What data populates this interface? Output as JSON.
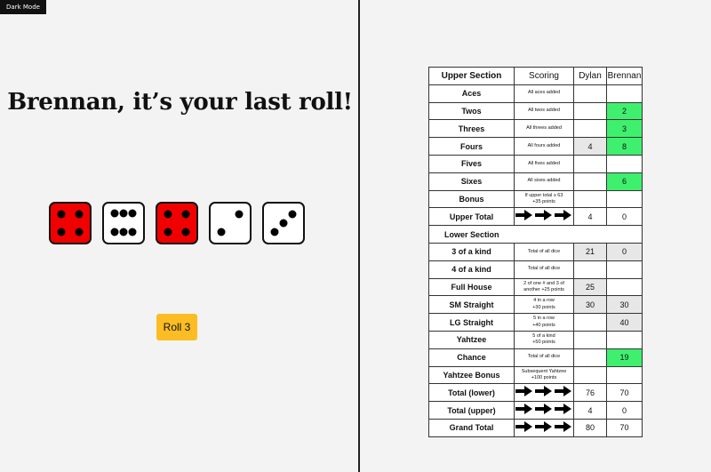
{
  "app": {
    "dark_mode_label": "Dark Mode"
  },
  "game": {
    "headline": "Brennan, it’s your last roll!",
    "roll_button": "Roll 3",
    "dice": [
      {
        "value": 4,
        "held": true
      },
      {
        "value": 6,
        "held": false
      },
      {
        "value": 4,
        "held": true
      },
      {
        "value": 2,
        "held": false
      },
      {
        "value": 3,
        "held": false
      }
    ]
  },
  "scorecard": {
    "headers": {
      "section": "Upper Section",
      "scoring": "Scoring",
      "player1": "Dylan",
      "player2": "Brennan"
    },
    "rows": [
      {
        "name": "Aces",
        "scoring": "All aces added",
        "p1": "",
        "p2": "",
        "p1_state": "",
        "p2_state": ""
      },
      {
        "name": "Twos",
        "scoring": "All twos added",
        "p1": "",
        "p2": "2",
        "p1_state": "",
        "p2_state": "green"
      },
      {
        "name": "Threes",
        "scoring": "All threes added",
        "p1": "",
        "p2": "3",
        "p1_state": "",
        "p2_state": "green"
      },
      {
        "name": "Fours",
        "scoring": "All fours added",
        "p1": "4",
        "p2": "8",
        "p1_state": "filled",
        "p2_state": "green"
      },
      {
        "name": "Fives",
        "scoring": "All fives added",
        "p1": "",
        "p2": "",
        "p1_state": "",
        "p2_state": ""
      },
      {
        "name": "Sixes",
        "scoring": "All sixes added",
        "p1": "",
        "p2": "6",
        "p1_state": "",
        "p2_state": "green"
      },
      {
        "name": "Bonus",
        "scoring": "If upper total ≥ 63\n+35 points",
        "p1": "",
        "p2": "",
        "p1_state": "",
        "p2_state": ""
      },
      {
        "name": "Upper Total",
        "arrows": true,
        "p1": "4",
        "p2": "0",
        "p1_state": "",
        "p2_state": ""
      },
      {
        "name": "Lower Section",
        "section": true
      },
      {
        "name": "3 of a kind",
        "scoring": "Total of all dice",
        "p1": "21",
        "p2": "0",
        "p1_state": "filled",
        "p2_state": "filled"
      },
      {
        "name": "4 of a kind",
        "scoring": "Total of all dice",
        "p1": "",
        "p2": "",
        "p1_state": "",
        "p2_state": ""
      },
      {
        "name": "Full House",
        "scoring": "2 of one # and 3 of\nanother +25 points",
        "p1": "25",
        "p2": "",
        "p1_state": "filled",
        "p2_state": ""
      },
      {
        "name": "SM Straight",
        "scoring": "4 in a row\n+30 points",
        "p1": "30",
        "p2": "30",
        "p1_state": "filled",
        "p2_state": "filled"
      },
      {
        "name": "LG Straight",
        "scoring": "5 in a row\n+40 points",
        "p1": "",
        "p2": "40",
        "p1_state": "",
        "p2_state": "filled"
      },
      {
        "name": "Yahtzee",
        "scoring": "5 of a kind\n+50 points",
        "p1": "",
        "p2": "",
        "p1_state": "",
        "p2_state": ""
      },
      {
        "name": "Chance",
        "scoring": "Total of all dice",
        "p1": "",
        "p2": "19",
        "p1_state": "",
        "p2_state": "green"
      },
      {
        "name": "Yahtzee Bonus",
        "scoring": "Subsequent Yahtzee\n+100 points",
        "p1": "",
        "p2": "",
        "p1_state": "",
        "p2_state": ""
      },
      {
        "name": "Total (lower)",
        "arrows": true,
        "p1": "76",
        "p2": "70",
        "p1_state": "",
        "p2_state": ""
      },
      {
        "name": "Total (upper)",
        "arrows": true,
        "p1": "4",
        "p2": "0",
        "p1_state": "",
        "p2_state": ""
      },
      {
        "name": "Grand Total",
        "arrows": true,
        "p1": "80",
        "p2": "70",
        "p1_state": "",
        "p2_state": ""
      }
    ]
  }
}
